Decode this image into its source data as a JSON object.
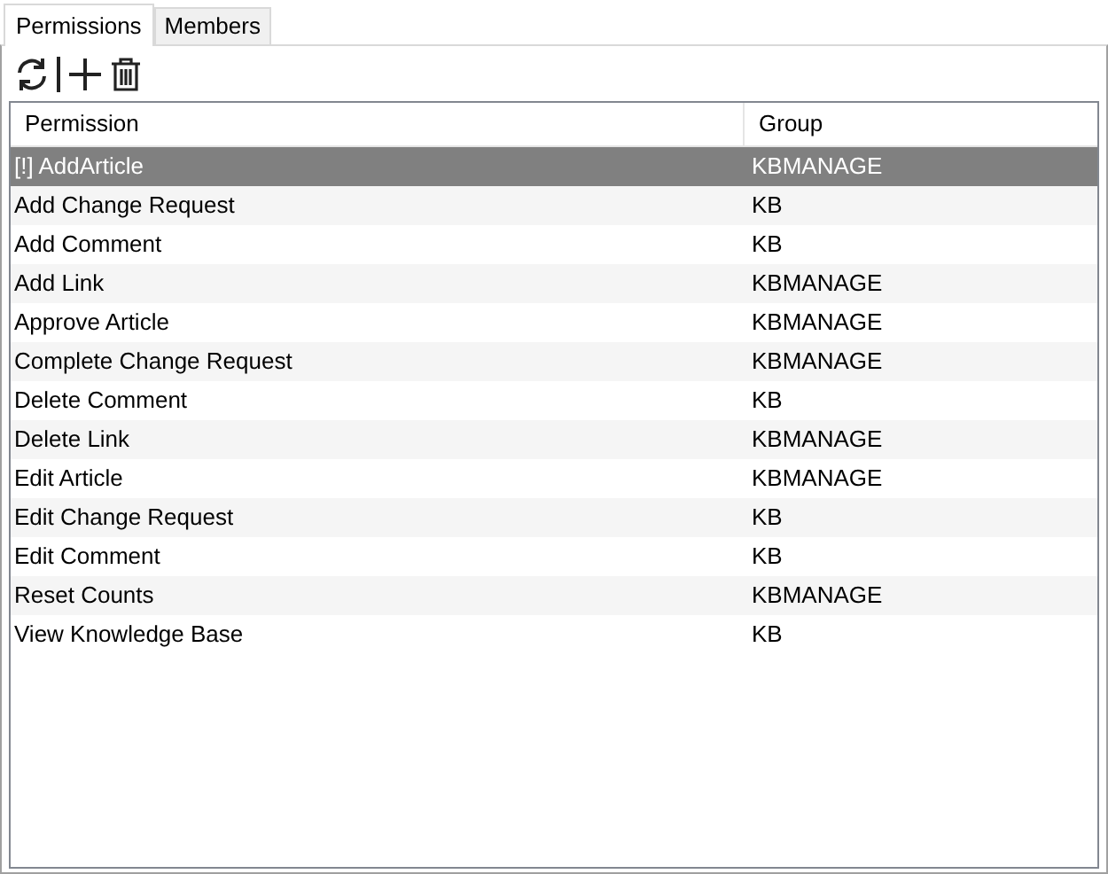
{
  "tabs": [
    {
      "label": "Permissions",
      "selected": true
    },
    {
      "label": "Members",
      "selected": false
    }
  ],
  "table": {
    "columns": [
      "Permission",
      "Group"
    ],
    "rows": [
      {
        "permission": "[!] AddArticle",
        "group": "KBMANAGE",
        "selected": true
      },
      {
        "permission": "Add Change Request",
        "group": "KB",
        "selected": false
      },
      {
        "permission": "Add Comment",
        "group": "KB",
        "selected": false
      },
      {
        "permission": "Add Link",
        "group": "KBMANAGE",
        "selected": false
      },
      {
        "permission": "Approve Article",
        "group": "KBMANAGE",
        "selected": false
      },
      {
        "permission": "Complete Change Request",
        "group": "KBMANAGE",
        "selected": false
      },
      {
        "permission": "Delete Comment",
        "group": "KB",
        "selected": false
      },
      {
        "permission": "Delete Link",
        "group": "KBMANAGE",
        "selected": false
      },
      {
        "permission": "Edit Article",
        "group": "KBMANAGE",
        "selected": false
      },
      {
        "permission": "Edit Change Request",
        "group": "KB",
        "selected": false
      },
      {
        "permission": "Edit Comment",
        "group": "KB",
        "selected": false
      },
      {
        "permission": "Reset Counts",
        "group": "KBMANAGE",
        "selected": false
      },
      {
        "permission": "View Knowledge Base",
        "group": "KB",
        "selected": false
      }
    ]
  }
}
